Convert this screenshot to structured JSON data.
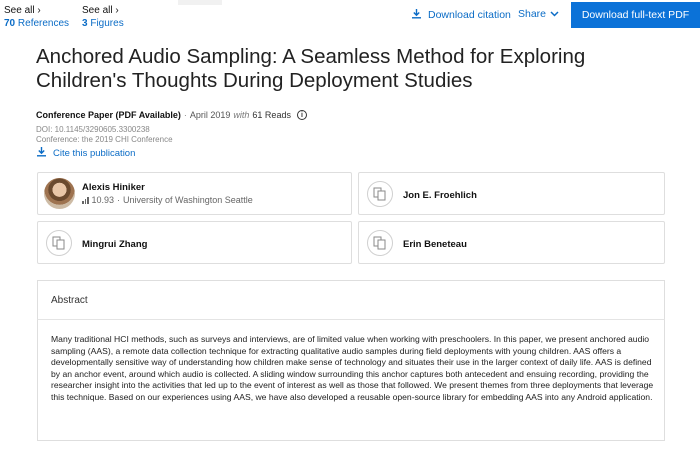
{
  "topbar": {
    "references": {
      "label": "See all ›",
      "count": "70",
      "noun": "References"
    },
    "figures": {
      "label": "See all ›",
      "count": "3",
      "noun": "Figures"
    },
    "download_citation": "Download citation",
    "share": "Share",
    "download_pdf": "Download full-text PDF"
  },
  "publication": {
    "title": "Anchored Audio Sampling: A Seamless Method for Exploring Children's Thoughts During Deployment Studies",
    "type": "Conference Paper (PDF Available)",
    "date": "April 2019",
    "with": "with",
    "reads": "61 Reads",
    "doi": "DOI: 10.1145/3290605.3300238",
    "conference": "Conference: the 2019 CHI Conference",
    "cite": "Cite this publication"
  },
  "authors": [
    {
      "name": "Alexis Hiniker",
      "score": "10.93",
      "affiliation": "University of Washington Seattle"
    },
    {
      "name": "Jon E. Froehlich"
    },
    {
      "name": "Mingrui Zhang"
    },
    {
      "name": "Erin Beneteau"
    }
  ],
  "abstract": {
    "heading": "Abstract",
    "text": "Many traditional HCI methods, such as surveys and interviews, are of limited value when working with preschoolers. In this paper, we present anchored audio sampling (AAS), a remote data collection technique for extracting qualitative audio samples during field deployments with young children. AAS offers a developmentally sensitive way of understanding how children make sense of technology and situates their use in the larger context of daily life. AAS is defined by an anchor event, around which audio is collected. A sliding window surrounding this anchor captures both antecedent and ensuing recording, providing the researcher insight into the activities that led up to the event of interest as well as those that followed. We present themes from three deployments that leverage this technique. Based on our experiences using AAS, we have also developed a reusable open-source library for embedding AAS into any Android application."
  },
  "colors": {
    "link": "#0b6cc6",
    "primary_button": "#0b72d8"
  },
  "icons": [
    "download-icon",
    "chevron-down-icon",
    "info-icon",
    "cite-download-icon",
    "rg-score-bars-icon",
    "author-placeholder-icon"
  ]
}
